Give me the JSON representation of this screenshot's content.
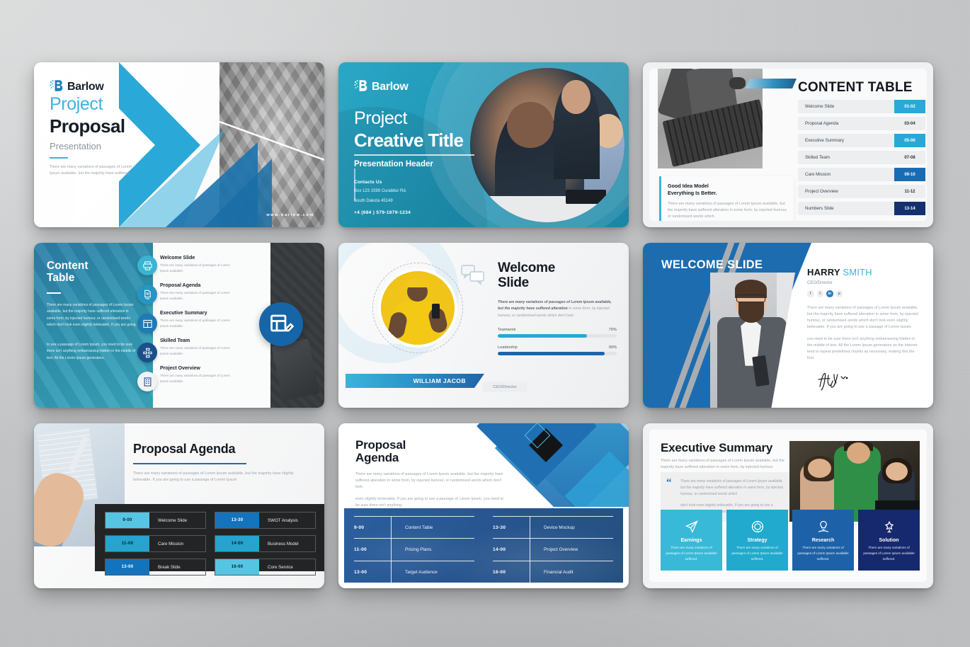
{
  "brand": {
    "name": "Barlow",
    "accent_cyan": "#3eb3dd",
    "accent_blue": "#1d6cb0",
    "accent_navy": "#1b3b74",
    "teal": "#2ba7c6"
  },
  "slide1": {
    "logo": "Barlow",
    "title_light": "Project",
    "title_bold": "Proposal",
    "subtitle": "Presentation",
    "body": "There are many variations of passages of Lorem Ipsum available, but the majority have suffered.",
    "website": "www.barlow.com"
  },
  "slide2": {
    "logo": "Barlow",
    "title_light": "Project",
    "title_bold": "Creative Title",
    "subtitle": "Presentation Header",
    "contacts_heading": "Contacts Us",
    "address_line1": "Box 123 1599 Curabitur Rd.",
    "address_line2": "South Dakota 45149",
    "phone": "+4 (684 ) 579-1879-1234"
  },
  "slide3": {
    "title": "CONTENT TABLE",
    "rows": [
      {
        "name": "Welcome Slide",
        "pages": "01-02",
        "style": "cyan"
      },
      {
        "name": "Proposal Agenda",
        "pages": "03-04",
        "style": "plain"
      },
      {
        "name": "Executive Summary",
        "pages": "05-06",
        "style": "cyan"
      },
      {
        "name": "Skilled Team",
        "pages": "07-08",
        "style": "plain"
      },
      {
        "name": "Care Mission",
        "pages": "09-10",
        "style": "blue"
      },
      {
        "name": "Project Overview",
        "pages": "11-12",
        "style": "plain"
      },
      {
        "name": "Numbers Slide",
        "pages": "13-14",
        "style": "navy"
      }
    ],
    "note_line1": "Good Idea Model",
    "note_line2": "Everything Is Better.",
    "note_body": "There are many variations of passages of Lorem Ipsum available, but the majority have suffered alteration in some form, by injected humour, or randomised words which."
  },
  "slide4": {
    "title_line1": "Content",
    "title_line2": "Table",
    "paragraph1": "There are many variations of passages of Lorem Ipsum available, but the majority have suffered alteration in some form, by injected humour, or randomised words which don't look even slightly believable. If you are going.",
    "paragraph2": "to use a passage of Lorem Ipsum, you need to be sure there isn't anything embarrassing hidden in the middle of text. All the Lorem Ipsum generators.",
    "items": [
      {
        "title": "Welcome Slide",
        "desc": "There are many variations of passages of Lorem Ipsum available.",
        "icon": "printer-icon",
        "color": "#39b4d3"
      },
      {
        "title": "Proposal Agenda",
        "desc": "There are many variations of passages of Lorem Ipsum available.",
        "icon": "document-hand-icon",
        "color": "#2596c4"
      },
      {
        "title": "Executive Summary",
        "desc": "There are many variations of passages of Lorem Ipsum available.",
        "icon": "layout-icon",
        "color": "#1f7ab5"
      },
      {
        "title": "Skilled Team",
        "desc": "There are many variations of passages of Lorem Ipsum available.",
        "icon": "org-chart-icon",
        "color": "#1a4f8c"
      },
      {
        "title": "Project Overview",
        "desc": "There are many variations of passages of Lorem Ipsum available.",
        "icon": "building-icon",
        "color": "#f1f2f3"
      }
    ]
  },
  "slide5": {
    "title_line1": "Welcome",
    "title_line2": "Slide",
    "body_bold": "There are many variations of passages of Lorem Ipsum available, but the majority have suffered alteration",
    "body_rest": " in some form, by injected humour, or randomised words which don't look.",
    "skills": [
      {
        "label": "Teamwork",
        "value": "75%",
        "pct": 75,
        "color": "#2ba7d4"
      },
      {
        "label": "Leadership",
        "value": "90%",
        "pct": 90,
        "color": "#1a66ae"
      }
    ],
    "person_name": "WILLIAM JACOB",
    "person_role": "CEO/Director"
  },
  "slide6": {
    "title": "WELCOME SLIDE",
    "name_first": "HARRY",
    "name_last": "SMITH",
    "role": "CEO/Director",
    "socials": [
      "f",
      "t",
      "in",
      "p"
    ],
    "paragraph1": "There are many variations of passages of Lorem Ipsum available, but the majority have suffered alteration in some form, by injected humour, or randomised words which don't look even slightly believable. If you are going to use a passage of Lorem Ipsum,",
    "paragraph2": "you need to be sure there isn't anything embarrassing hidden in the middle of text. All the Lorem Ipsum generators on the internet tend to repeat predefined chunks as necessary, making this the first."
  },
  "slide7": {
    "title": "Proposal Agenda",
    "body": "There are many variations of passages of Lorem Ipsum available, but the majority have slightly believable. If you are going to use a passage of Lorem Ipsum",
    "agenda": [
      {
        "time": "9-00",
        "label": "Welcome Slide",
        "color": "#55c5e3"
      },
      {
        "time": "13-30",
        "label": "SWOT Analysis",
        "color": "#1374bd"
      },
      {
        "time": "11-00",
        "label": "Care Mission",
        "color": "#25a4cf"
      },
      {
        "time": "14-00",
        "label": "Business Model",
        "color": "#25a4cf"
      },
      {
        "time": "13-00",
        "label": "Break Slide",
        "color": "#1374bd"
      },
      {
        "time": "16-00",
        "label": "Core Service",
        "color": "#55c5e3"
      }
    ]
  },
  "slide8": {
    "title_line1": "Proposal",
    "title_line2": "Agenda",
    "paragraph1": "There are many variations of passages of Lorem Ipsum available, but the majority have suffered alteration in some form, by injected humour, or randomised words which don't look.",
    "paragraph2": "even slightly believable. If you are going to use a passage of Lorem Ipsum, you need to be sure there isn't anything.",
    "left_rows": [
      {
        "time": "9-00",
        "label": "Content Table"
      },
      {
        "time": "11-00",
        "label": "Pricing Plans"
      },
      {
        "time": "13-00",
        "label": "Target Audience"
      }
    ],
    "right_rows": [
      {
        "time": "13-30",
        "label": "Device Mockup"
      },
      {
        "time": "14-00",
        "label": "Project Overview"
      },
      {
        "time": "16-00",
        "label": "Financial Audit"
      }
    ]
  },
  "slide9": {
    "title": "Executive Summary",
    "lead": "There are many variations of passages of Lorem Ipsum available, but the majority have suffered alteration in some form, by injected humour.",
    "quote_bold": "There are many variations of passages of Lorem Ipsum available, but the majority have suffered alteration in same form,",
    "quote_rest": " by injected humour, or randomised words which",
    "quote_body": "don't look even slightly believable. If you are going to use a passage of Lorem Ipsum, you need to be sure there isn't anything.",
    "cards": [
      {
        "title": "Earnings",
        "desc": "There are many variations of passages of Lorem Ipsum available suffered.",
        "color": "#39b9d8",
        "icon": "paper-plane-icon"
      },
      {
        "title": "Strategy",
        "desc": "There are many variations of passages of Lorem Ipsum available suffered.",
        "color": "#21aace",
        "icon": "target-coin-icon"
      },
      {
        "title": "Research",
        "desc": "There are many variations of passages of Lorem Ipsum available suffered.",
        "color": "#1d62a8",
        "icon": "idea-hand-icon"
      },
      {
        "title": "Solution",
        "desc": "There are many variations of passages of Lorem Ipsum available suffered.",
        "color": "#16296e",
        "icon": "puzzle-star-icon"
      }
    ]
  }
}
